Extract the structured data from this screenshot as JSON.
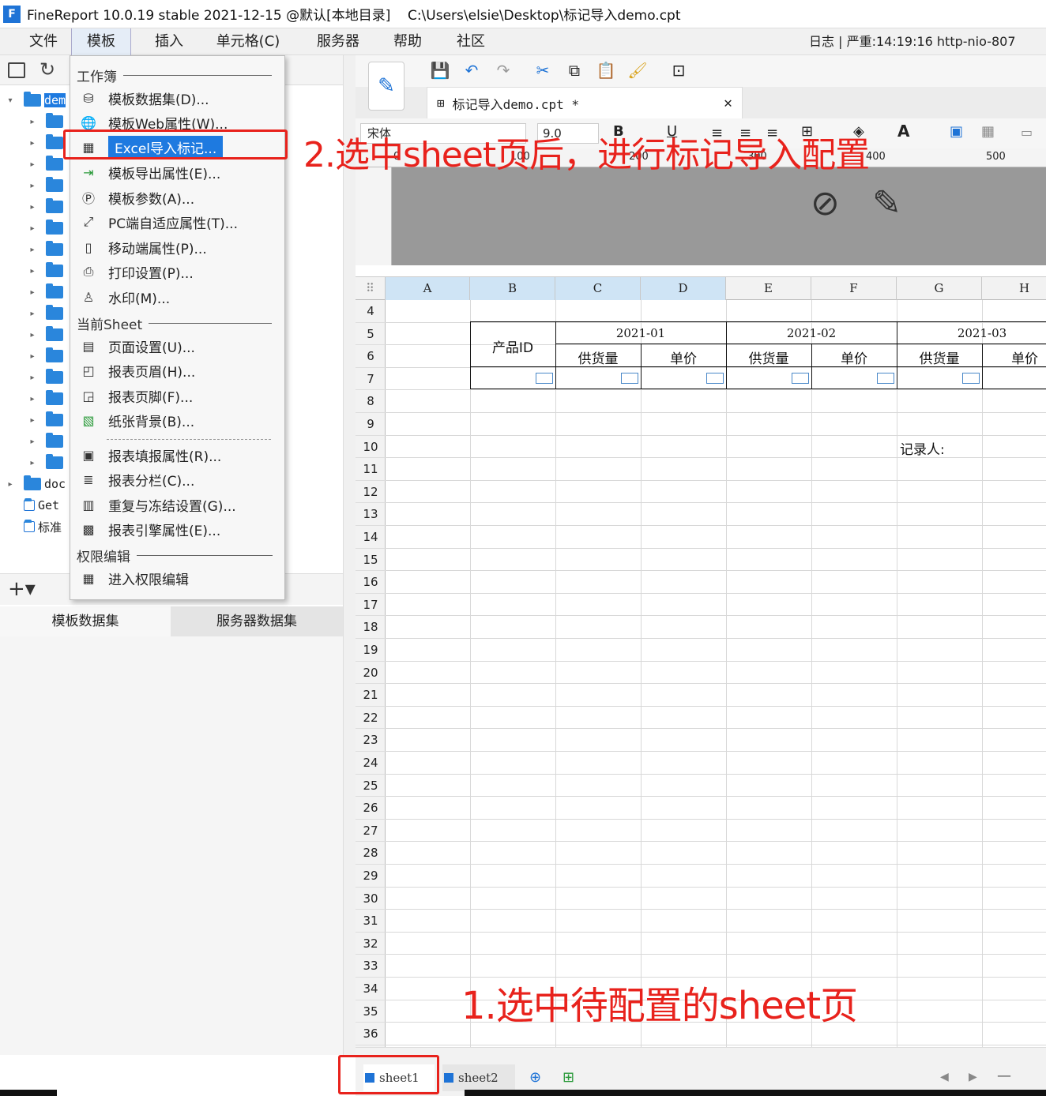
{
  "title": {
    "app_title": "FineReport 10.0.19 stable 2021-12-15 @默认[本地目录]",
    "file_path": "C:\\Users\\elsie\\Desktop\\标记导入demo.cpt",
    "logo_letter": "F"
  },
  "menubar": {
    "items": [
      "文件",
      "模板",
      "插入",
      "单元格(C)",
      "服务器",
      "帮助",
      "社区"
    ],
    "status_log": "日志 | 严重:14:19:16 http-nio-807"
  },
  "tree": {
    "items": [
      "dem",
      "",
      "",
      "",
      "",
      "",
      "",
      "",
      "",
      "",
      "",
      "",
      "",
      "",
      "",
      "",
      "",
      "",
      "doc",
      "Get",
      "标准"
    ]
  },
  "dataset_tabs": [
    "模板数据集",
    "服务器数据集"
  ],
  "template_menu": {
    "sec_workbook": "工作簿",
    "sec_current_sheet": "当前Sheet",
    "sec_permission": "权限编辑",
    "items": [
      {
        "label": "模板数据集(D)...",
        "icon": "database-icon"
      },
      {
        "label": "模板Web属性(W)...",
        "icon": "globe-icon"
      },
      {
        "label": "Excel导入标记...",
        "icon": "excel-import-icon",
        "selected": true
      },
      {
        "label": "模板导出属性(E)...",
        "icon": "export-icon"
      },
      {
        "label": "模板参数(A)...",
        "icon": "parameter-icon"
      },
      {
        "label": "PC端自适应属性(T)...",
        "icon": "adaptive-icon"
      },
      {
        "label": "移动端属性(P)...",
        "icon": "mobile-icon"
      },
      {
        "label": "打印设置(P)...",
        "icon": "printer-icon"
      },
      {
        "label": "水印(M)...",
        "icon": "stamp-icon"
      },
      {
        "label": "页面设置(U)...",
        "icon": "page-setup-icon"
      },
      {
        "label": "报表页眉(H)...",
        "icon": "header-icon"
      },
      {
        "label": "报表页脚(F)...",
        "icon": "footer-icon"
      },
      {
        "label": "纸张背景(B)...",
        "icon": "background-image-icon"
      },
      {
        "label": "报表填报属性(R)...",
        "icon": "fill-attr-icon"
      },
      {
        "label": "报表分栏(C)...",
        "icon": "columns-icon"
      },
      {
        "label": "重复与冻结设置(G)...",
        "icon": "freeze-icon"
      },
      {
        "label": "报表引擎属性(E)...",
        "icon": "engine-icon"
      },
      {
        "label": "进入权限编辑",
        "icon": "permission-icon"
      }
    ]
  },
  "annotations": {
    "step2": "2.选中sheet页后，进行标记导入配置",
    "step1": "1.选中待配置的sheet页"
  },
  "editor": {
    "file_tab": "标记导入demo.cpt *",
    "font_name": "宋体",
    "font_size": "9.0",
    "ruler_marks": [
      "0",
      "100",
      "200",
      "300",
      "400",
      "500"
    ],
    "columns": [
      "A",
      "B",
      "C",
      "D",
      "E",
      "F",
      "G",
      "H"
    ],
    "rows": [
      "4",
      "5",
      "6",
      "7",
      "8",
      "9",
      "10",
      "11",
      "12",
      "13",
      "14",
      "15",
      "16",
      "17",
      "18",
      "19",
      "20",
      "21",
      "22",
      "23",
      "24",
      "25",
      "26",
      "27",
      "28",
      "29",
      "30",
      "31",
      "32",
      "33",
      "34",
      "35",
      "36"
    ],
    "cells": {
      "product_id": "产品ID",
      "month1": "2021-01",
      "month2": "2021-02",
      "month3": "2021-03",
      "supply": "供货量",
      "price": "单价",
      "recorder": "记录人:"
    },
    "sheets": [
      "sheet1",
      "sheet2"
    ]
  },
  "colors": {
    "accent": "#1e7ae0",
    "annotation": "#e8221c"
  }
}
